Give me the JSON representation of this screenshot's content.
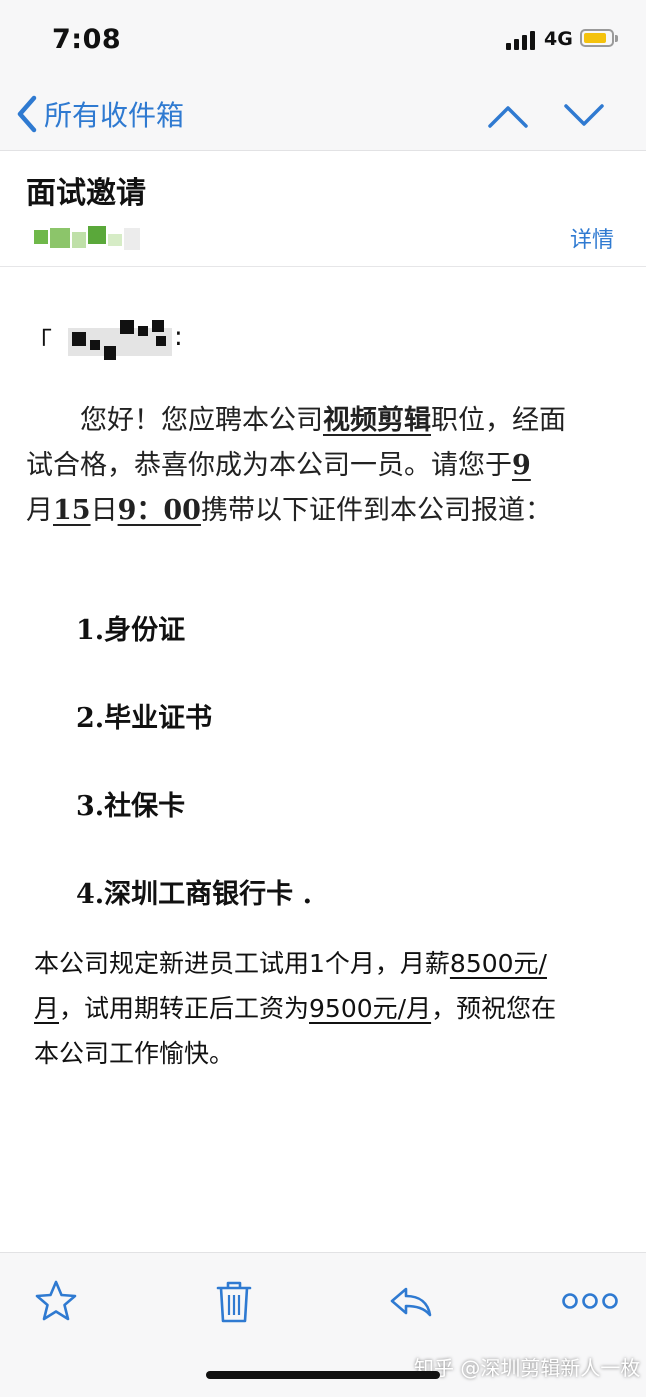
{
  "status_bar": {
    "time": "7:08",
    "network": "4G",
    "battery_color": "#f4c20d"
  },
  "nav": {
    "back_label": "所有收件箱",
    "accent_color": "#2f7ad1",
    "icons": [
      "chevron-left-icon",
      "chevron-up-icon",
      "chevron-down-icon"
    ]
  },
  "email": {
    "subject": "面试邀请",
    "details_label": "详情",
    "greeting_colon": ":",
    "greeting_bracket": "「",
    "paragraph1": {
      "line1_a": "您好！您应聘本公司",
      "line1_b": "视频剪辑",
      "line1_c": "职位，经面",
      "line2_a": "试合格，恭喜你成为本公司一员。请您于",
      "line2_b": "9",
      "line3_a": "月",
      "line3_b": "15",
      "line3_c": "日",
      "line3_d": "9：00",
      "line3_e": "携带以下证件到本公司报道："
    },
    "documents": [
      "1.身份证",
      "2.毕业证书",
      "3.社保卡",
      "4.深圳工商银行卡 ."
    ],
    "paragraph2": {
      "line1_a": "本公司规定新进员工试用1个月，月薪",
      "line1_b": "8500元/",
      "line2_a": "月",
      "line2_b": "，试用期转正后工资为",
      "line2_c": "9500元/月",
      "line2_d": "，预祝您在",
      "line3": "本公司工作愉快。"
    }
  },
  "toolbar": {
    "icons": [
      "star-icon",
      "trash-icon",
      "reply-icon",
      "more-icon"
    ]
  },
  "watermark": "知乎 @深圳剪辑新人一枚"
}
